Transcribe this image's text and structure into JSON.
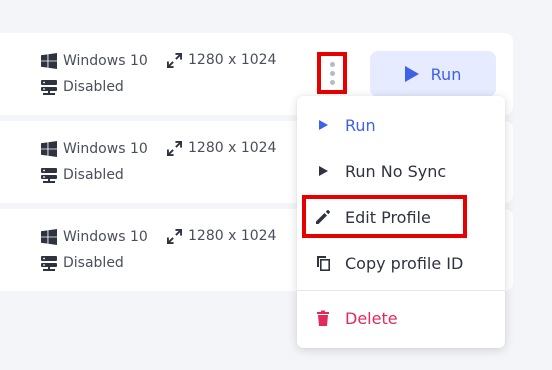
{
  "rows": [
    {
      "os": "Windows 10",
      "proxy": "Disabled",
      "resolution": "1280 x 1024"
    },
    {
      "os": "Windows 10",
      "proxy": "Disabled",
      "resolution": "1280 x 1024"
    },
    {
      "os": "Windows 10",
      "proxy": "Disabled",
      "resolution": "1280 x 1024"
    }
  ],
  "run_button": {
    "label": "Run"
  },
  "menu": {
    "run": "Run",
    "run_no_sync": "Run No Sync",
    "edit_profile": "Edit Profile",
    "copy_profile_id": "Copy profile ID",
    "delete": "Delete"
  },
  "colors": {
    "accent": "#3f61e8",
    "danger": "#e3285b",
    "highlight": "#e60000",
    "run_bg": "#e7ebff"
  },
  "icons": {
    "os": "windows-icon",
    "proxy": "server-icon",
    "resolution": "expand-icon",
    "more": "kebab-icon",
    "run": "play-icon",
    "edit": "pencil-icon",
    "copy": "copy-icon",
    "delete": "trash-icon"
  }
}
